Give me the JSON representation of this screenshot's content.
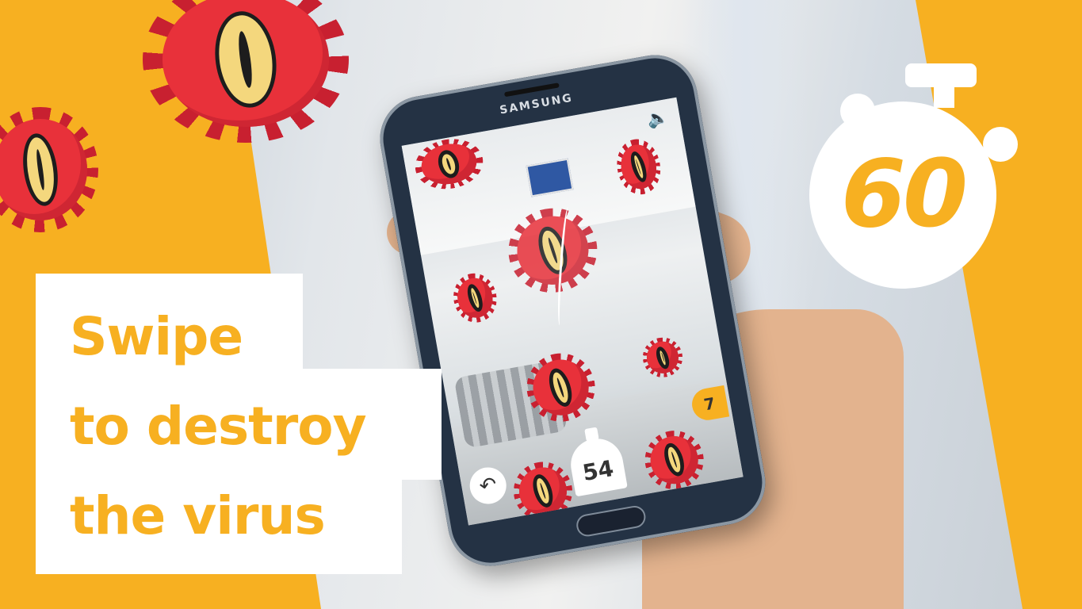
{
  "promo": {
    "caption_lines": [
      "Swipe",
      "to destroy",
      "the virus"
    ],
    "countdown": "60"
  },
  "colors": {
    "accent": "#f7b021",
    "virus_red": "#e8313a",
    "phone_body": "#243244"
  },
  "phone": {
    "brand": "SAMSUNG"
  },
  "game": {
    "timer_value": "54",
    "score": "7",
    "icons": {
      "mute": "mute-speaker-icon",
      "back": "back-arrow-icon",
      "timer": "stopwatch-icon"
    }
  }
}
